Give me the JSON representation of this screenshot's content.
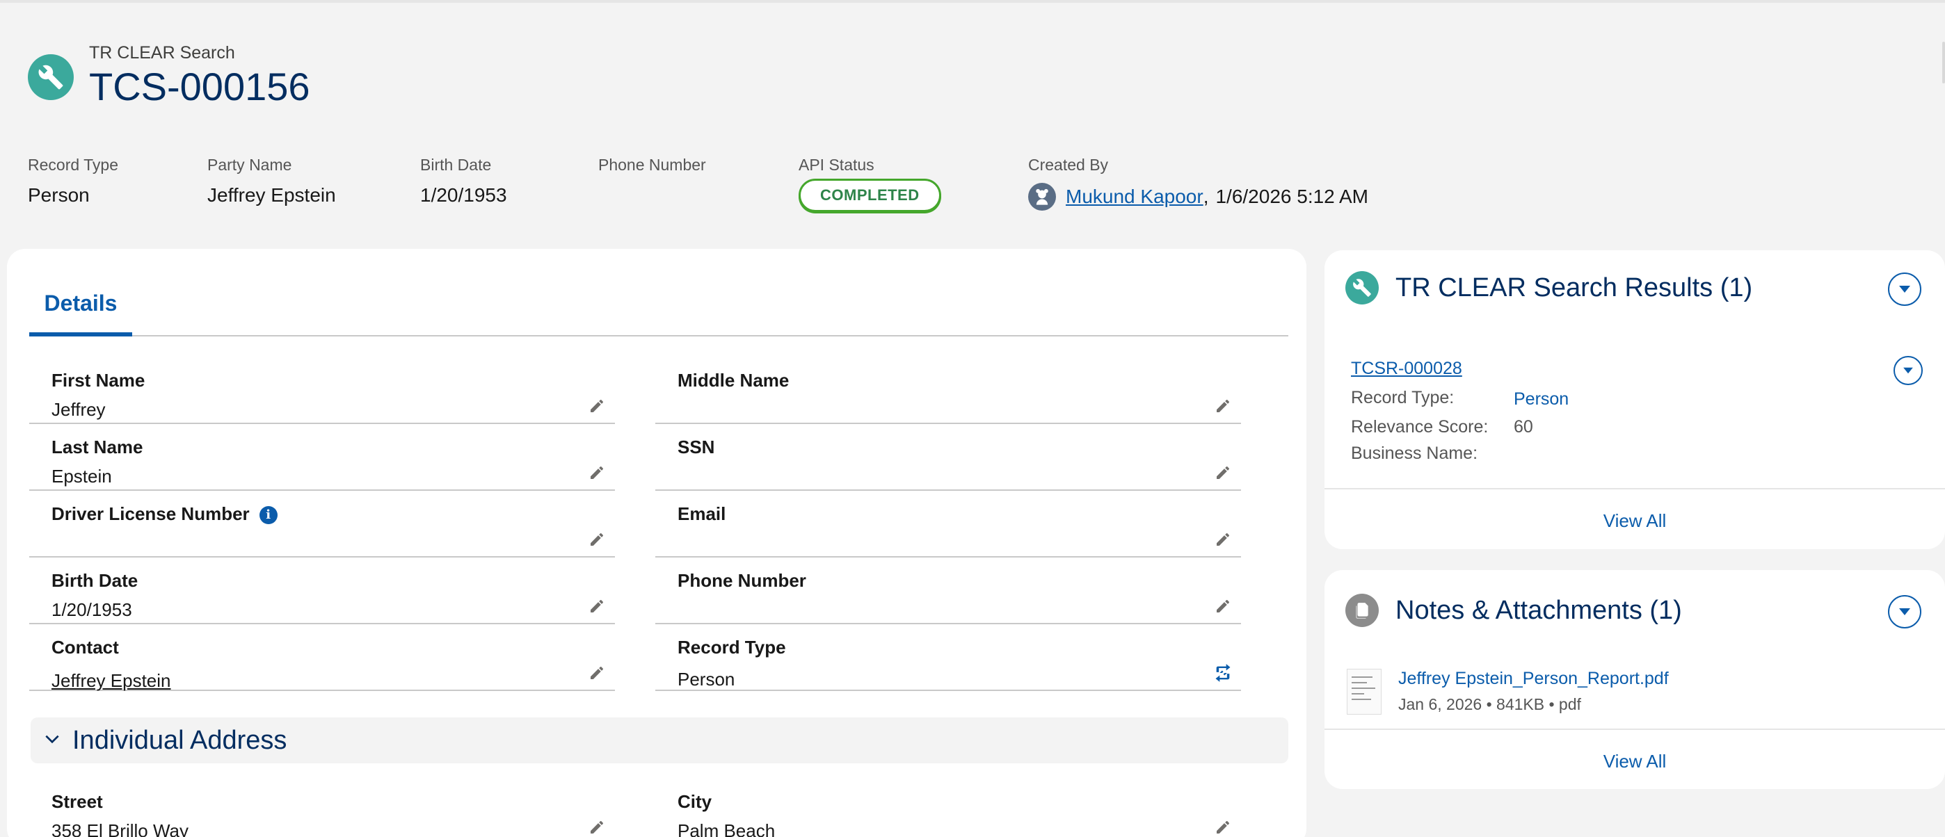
{
  "header": {
    "object_label": "TR CLEAR Search",
    "record_name": "TCS-000156",
    "icon": "wrench-icon"
  },
  "highlights": {
    "record_type": {
      "label": "Record Type",
      "value": "Person"
    },
    "party_name": {
      "label": "Party Name",
      "value": "Jeffrey Epstein"
    },
    "birth_date": {
      "label": "Birth Date",
      "value": "1/20/1953"
    },
    "phone_number": {
      "label": "Phone Number",
      "value": ""
    },
    "api_status": {
      "label": "API Status",
      "value": "COMPLETED"
    },
    "created_by": {
      "label": "Created By",
      "user": "Mukund Kapoor",
      "separator": ",",
      "datetime": "1/6/2026 5:12 AM"
    }
  },
  "tabs": {
    "details": "Details"
  },
  "details": {
    "first_name": {
      "label": "First Name",
      "value": "Jeffrey"
    },
    "middle_name": {
      "label": "Middle Name",
      "value": ""
    },
    "last_name": {
      "label": "Last Name",
      "value": "Epstein"
    },
    "ssn": {
      "label": "SSN",
      "value": ""
    },
    "driver_license": {
      "label": "Driver License Number",
      "value": "",
      "info_glyph": "i"
    },
    "email": {
      "label": "Email",
      "value": ""
    },
    "birth_date": {
      "label": "Birth Date",
      "value": "1/20/1953"
    },
    "phone_number": {
      "label": "Phone Number",
      "value": ""
    },
    "contact": {
      "label": "Contact",
      "value": "Jeffrey Epstein"
    },
    "record_type": {
      "label": "Record Type",
      "value": "Person"
    }
  },
  "individual_address": {
    "title": "Individual Address",
    "street": {
      "label": "Street",
      "value": "358 El Brillo Way"
    },
    "city": {
      "label": "City",
      "value": "Palm Beach"
    }
  },
  "search_results": {
    "title": "TR CLEAR Search Results (1)",
    "record": {
      "name": "TCSR-000028",
      "record_type_label": "Record Type:",
      "record_type_value": "Person",
      "relevance_label": "Relevance Score:",
      "relevance_value": "60",
      "business_label": "Business Name:",
      "business_value": ""
    },
    "view_all": "View All"
  },
  "notes": {
    "title": "Notes & Attachments (1)",
    "file_name": "Jeffrey Epstein_Person_Report.pdf",
    "file_meta": "Jan 6, 2026 • 841KB • pdf",
    "view_all": "View All"
  },
  "colors": {
    "brand_teal": "#3ba99c",
    "link_blue": "#0b5cab",
    "title_navy": "#032d60",
    "status_green": "#45a72c",
    "page_bg": "#f3f3f3"
  }
}
